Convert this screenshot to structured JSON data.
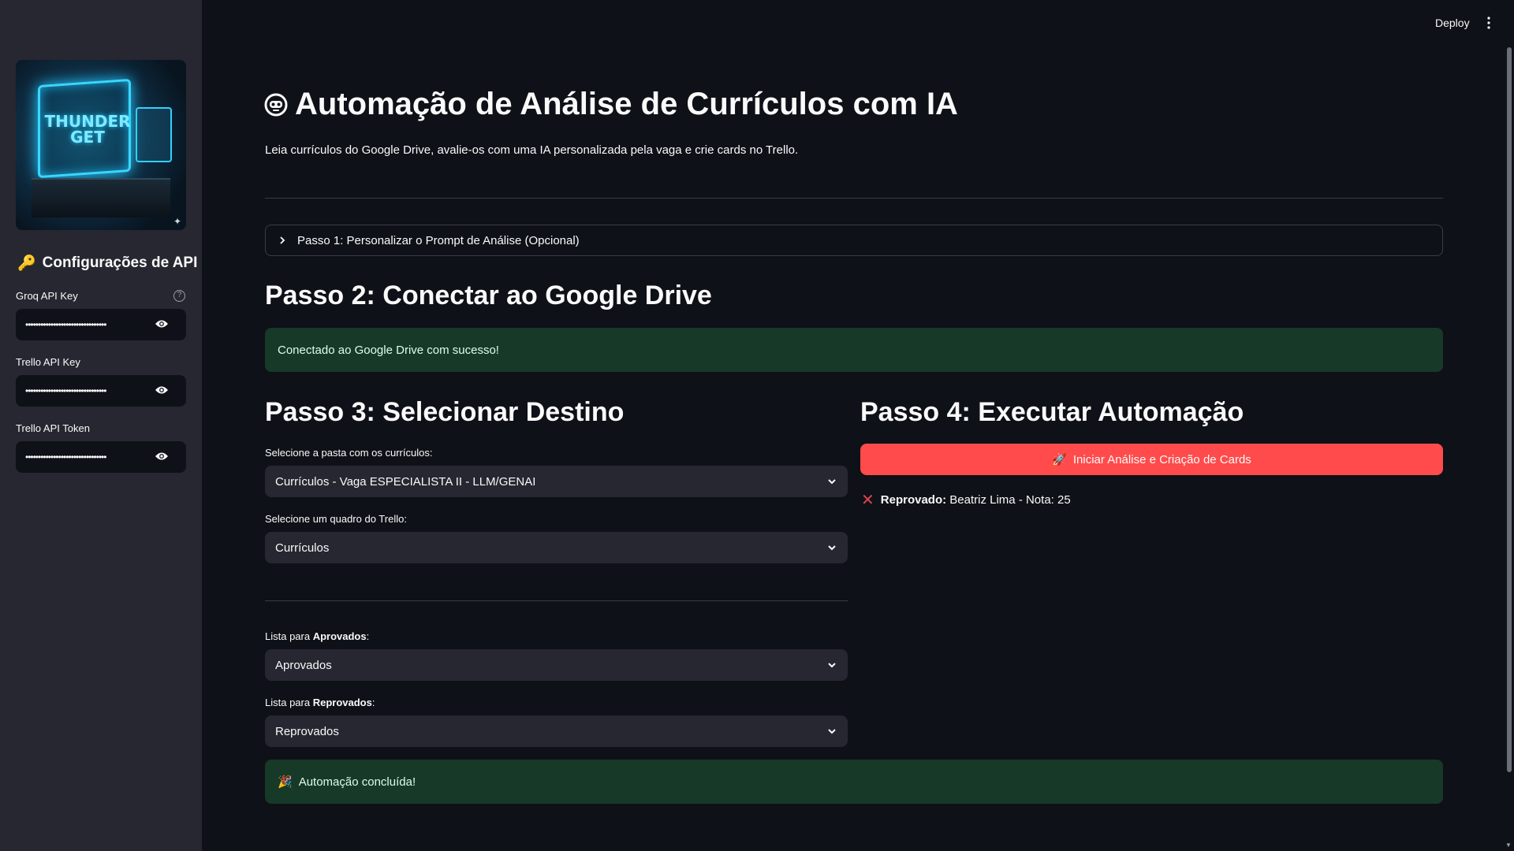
{
  "header": {
    "deploy_label": "Deploy",
    "menu_icon": "kebab-menu-icon"
  },
  "sidebar": {
    "logo_text": "THUNDER GET",
    "section_title": "Configurações de API",
    "section_icon": "key-icon",
    "fields": [
      {
        "label": "Groq API Key",
        "value": "••••••••••••••••••••••••••••••••",
        "has_help": true
      },
      {
        "label": "Trello API Key",
        "value": "••••••••••••••••••••••••••••••••"
      },
      {
        "label": "Trello API Token",
        "value": "••••••••••••••••••••••••••••••••"
      }
    ]
  },
  "main": {
    "title": "Automação de Análise de Currículos com IA",
    "title_icon": "robot-face-icon",
    "subtitle": "Leia currículos do Google Drive, avalie-os com uma IA personalizada pela vaga e crie cards no Trello.",
    "step1": {
      "label": "Passo 1: Personalizar o Prompt de Análise (Opcional)"
    },
    "step2": {
      "heading": "Passo 2: Conectar ao Google Drive",
      "success": "Conectado ao Google Drive com sucesso!"
    },
    "step3": {
      "heading": "Passo 3: Selecionar Destino",
      "folder_label": "Selecione a pasta com os currículos:",
      "folder_value": "Currículos - Vaga ESPECIALISTA II - LLM/GENAI",
      "board_label": "Selecione um quadro do Trello:",
      "board_value": "Currículos",
      "approved_label_prefix": "Lista para ",
      "approved_label_bold": "Aprovados",
      "approved_label_suffix": ":",
      "approved_value": "Aprovados",
      "rejected_label_prefix": "Lista para ",
      "rejected_label_bold": "Reprovados",
      "rejected_label_suffix": ":",
      "rejected_value": "Reprovados"
    },
    "step4": {
      "heading": "Passo 4: Executar Automação",
      "button_label": "Iniciar Análise e Criação de Cards",
      "button_icon": "rocket-icon",
      "result_icon": "x-mark-icon",
      "result_bold": "Reprovado:",
      "result_text": "Beatriz Lima - Nota: 25"
    },
    "final": {
      "icon": "party-popper-icon",
      "message": "Automação concluída!"
    }
  },
  "colors": {
    "background": "#0e1117",
    "sidebar": "#262730",
    "accent": "#ff4b4b",
    "success_bg": "#173928",
    "error": "#e0454f"
  }
}
